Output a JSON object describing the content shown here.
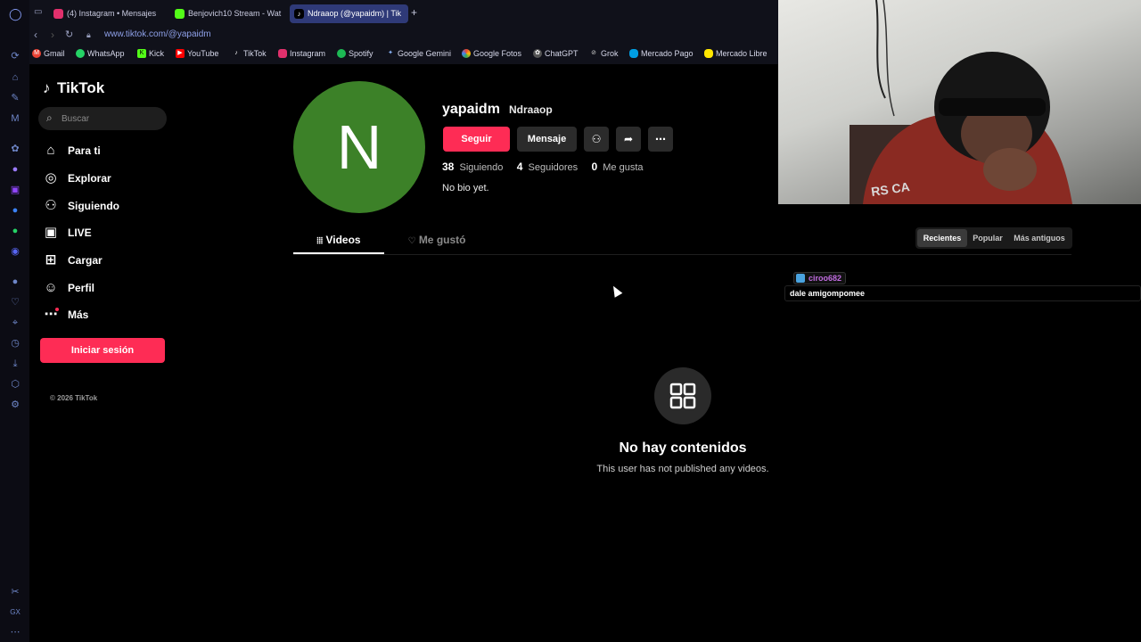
{
  "browser": {
    "tabs": [
      {
        "label": "(4) Instagram • Mensajes",
        "icon": "instagram-icon",
        "color": "#e1306c"
      },
      {
        "label": "Benjovich10 Stream - Wat",
        "icon": "kick-icon",
        "color": "#53fc18"
      },
      {
        "label": "Ndraaop (@yapaidm) | Tik",
        "icon": "tiktok-icon",
        "color": "#000000",
        "active": true
      }
    ],
    "new_tab": "+",
    "url": "www.tiktok.com/@yapaidm",
    "bookmarks": [
      {
        "label": "Gmail",
        "icon": "gmail-icon",
        "color": "#ea4335"
      },
      {
        "label": "WhatsApp",
        "icon": "whatsapp-icon",
        "color": "#25d366"
      },
      {
        "label": "Kick",
        "icon": "kick-icon",
        "color": "#53fc18"
      },
      {
        "label": "YouTube",
        "icon": "youtube-icon",
        "color": "#ff0000"
      },
      {
        "label": "TikTok",
        "icon": "tiktok-icon",
        "color": "#ffffff"
      },
      {
        "label": "Instagram",
        "icon": "instagram-icon",
        "color": "#e1306c"
      },
      {
        "label": "Spotify",
        "icon": "spotify-icon",
        "color": "#1db954"
      },
      {
        "label": "Google Gemini",
        "icon": "gemini-icon",
        "color": "#8ab4f8"
      },
      {
        "label": "Google Fotos",
        "icon": "google-photos-icon",
        "color": "#fbbc04"
      },
      {
        "label": "ChatGPT",
        "icon": "chatgpt-icon",
        "color": "#aaaaaa"
      },
      {
        "label": "Grok",
        "icon": "grok-icon",
        "color": "#cccccc"
      },
      {
        "label": "Mercado Pago",
        "icon": "mercado-pago-icon",
        "color": "#009ee3"
      },
      {
        "label": "Mercado Libre",
        "icon": "mercado-libre-icon",
        "color": "#ffe600"
      }
    ]
  },
  "tiktok": {
    "logo": "TikTok",
    "search_placeholder": "Buscar",
    "nav": [
      {
        "label": "Para ti",
        "icon": "home-icon"
      },
      {
        "label": "Explorar",
        "icon": "compass-icon"
      },
      {
        "label": "Siguiendo",
        "icon": "following-icon"
      },
      {
        "label": "LIVE",
        "icon": "live-icon"
      },
      {
        "label": "Cargar",
        "icon": "upload-icon"
      },
      {
        "label": "Perfil",
        "icon": "profile-icon"
      },
      {
        "label": "Más",
        "icon": "more-icon"
      }
    ],
    "login": "Iniciar sesión",
    "copyright": "© 2026 TikTok"
  },
  "profile": {
    "avatar_letter": "N",
    "avatar_color": "#3c8128",
    "username": "yapaidm",
    "nickname": "Ndraaop",
    "follow": "Seguir",
    "message": "Mensaje",
    "following_count": "38",
    "following_label": "Siguiendo",
    "followers_count": "4",
    "followers_label": "Seguidores",
    "likes_count": "0",
    "likes_label": "Me gusta",
    "bio": "No bio yet.",
    "tabs": {
      "videos": "Videos",
      "liked": "Me gustó"
    },
    "sort": [
      "Recientes",
      "Popular",
      "Más antiguos"
    ],
    "empty_title": "No hay contenidos",
    "empty_sub": "This user has not published any videos."
  },
  "chat": {
    "user": "ciroo682",
    "message": "dale amigompomee"
  },
  "colors": {
    "accent": "#fe2c55",
    "tab_active": "#2f3a78"
  }
}
